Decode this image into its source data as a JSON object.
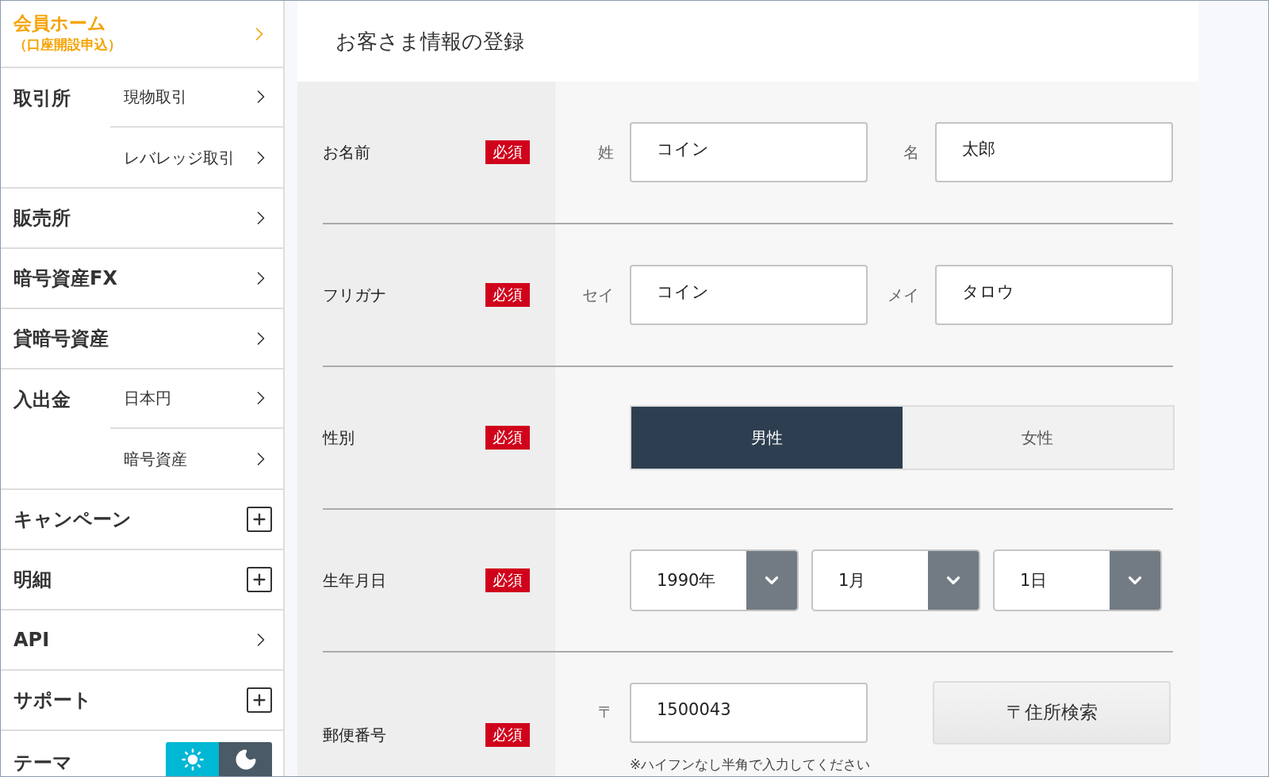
{
  "sidebar": {
    "home": {
      "title": "会員ホーム",
      "subtitle": "（口座開設申込）"
    },
    "items": [
      {
        "kind": "group",
        "label": "取引所",
        "children": [
          {
            "label": "現物取引"
          },
          {
            "label": "レバレッジ取引"
          }
        ]
      },
      {
        "kind": "link",
        "label": "販売所"
      },
      {
        "kind": "link",
        "label": "暗号資産FX"
      },
      {
        "kind": "link",
        "label": "貸暗号資産"
      },
      {
        "kind": "group",
        "label": "入出金",
        "children": [
          {
            "label": "日本円"
          },
          {
            "label": "暗号資産"
          }
        ]
      },
      {
        "kind": "expand",
        "label": "キャンペーン",
        "expanded": false
      },
      {
        "kind": "expand",
        "label": "明細",
        "expanded": false
      },
      {
        "kind": "link",
        "label": "API"
      },
      {
        "kind": "expand",
        "label": "サポート",
        "expanded": false
      },
      {
        "kind": "theme",
        "label": "テーマ",
        "modes": [
          {
            "kind": "light",
            "selected": true
          },
          {
            "kind": "dark",
            "selected": false
          }
        ]
      }
    ]
  },
  "form": {
    "title": "お客さま情報の登録",
    "rows": [
      {
        "kind": "pair",
        "label": "お名前",
        "badge": "必須",
        "fields": [
          {
            "prefix": "姓",
            "value": "コイン"
          },
          {
            "prefix": "名",
            "value": "太郎"
          }
        ]
      },
      {
        "kind": "pair",
        "label": "フリガナ",
        "badge": "必須",
        "fields": [
          {
            "prefix": "セイ",
            "value": "コイン"
          },
          {
            "prefix": "メイ",
            "value": "タロウ"
          }
        ]
      },
      {
        "kind": "choice",
        "label": "性別",
        "badge": "必須",
        "options": [
          {
            "label": "男性",
            "selected": true
          },
          {
            "label": "女性",
            "selected": false
          }
        ]
      },
      {
        "kind": "selects",
        "label": "生年月日",
        "badge": "必須",
        "selects": [
          {
            "value": "1990年"
          },
          {
            "value": "1月"
          },
          {
            "value": "1日"
          }
        ]
      },
      {
        "kind": "postal",
        "label": "郵便番号",
        "badge": "必須",
        "prefix": "〒",
        "value": "1500043",
        "button": "〒住所検索",
        "note": "※ハイフンなし半角で入力してください"
      }
    ]
  }
}
